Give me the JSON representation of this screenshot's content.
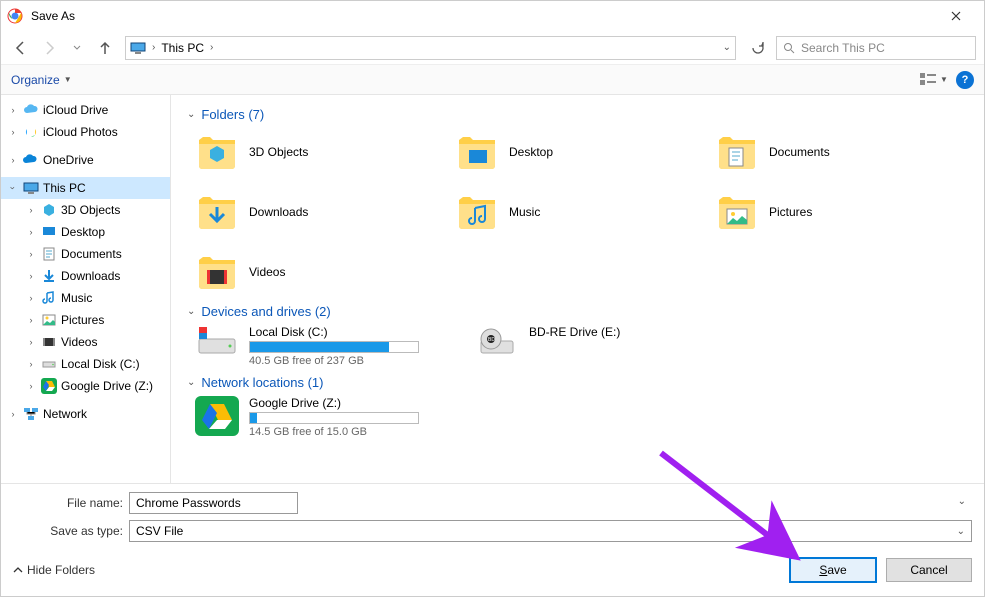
{
  "title": "Save As",
  "breadcrumb": {
    "location": "This PC"
  },
  "search": {
    "placeholder": "Search This PC"
  },
  "toolbar": {
    "organize": "Organize"
  },
  "tree": {
    "items": [
      {
        "label": "iCloud Drive"
      },
      {
        "label": "iCloud Photos"
      },
      {
        "label": "OneDrive"
      },
      {
        "label": "This PC"
      },
      {
        "label": "3D Objects"
      },
      {
        "label": "Desktop"
      },
      {
        "label": "Documents"
      },
      {
        "label": "Downloads"
      },
      {
        "label": "Music"
      },
      {
        "label": "Pictures"
      },
      {
        "label": "Videos"
      },
      {
        "label": "Local Disk (C:)"
      },
      {
        "label": "Google Drive (Z:)"
      },
      {
        "label": "Network"
      }
    ]
  },
  "groups": {
    "folders": {
      "header": "Folders (7)",
      "items": [
        "3D Objects",
        "Desktop",
        "Documents",
        "Downloads",
        "Music",
        "Pictures",
        "Videos"
      ]
    },
    "drives": {
      "header": "Devices and drives (2)",
      "items": [
        {
          "name": "Local Disk (C:)",
          "free": "40.5 GB free of 237 GB",
          "pct": 83
        },
        {
          "name": "BD-RE Drive (E:)"
        }
      ]
    },
    "network": {
      "header": "Network locations (1)",
      "items": [
        {
          "name": "Google Drive (Z:)",
          "free": "14.5 GB free of 15.0 GB",
          "pct": 4
        }
      ]
    }
  },
  "filename": {
    "label": "File name:",
    "value": "Chrome Passwords"
  },
  "savetype": {
    "label": "Save as type:",
    "value": "CSV File"
  },
  "buttons": {
    "save": "Save",
    "cancel": "Cancel",
    "hide": "Hide Folders"
  }
}
